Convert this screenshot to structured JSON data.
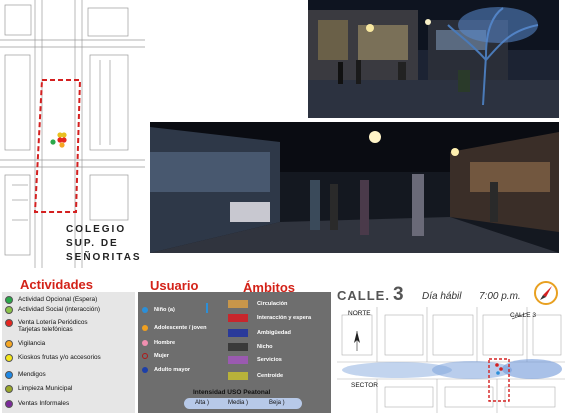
{
  "site_plan": {
    "caption_lines": [
      "COLEGIO",
      "SUP. DE",
      "SEÑORITAS"
    ]
  },
  "photos": {
    "top": {
      "subject": "night street corner with tree sculpture"
    },
    "bottom": {
      "subject": "night pedestrian street with people walking"
    }
  },
  "actividades": {
    "heading": "Actividades",
    "items": [
      {
        "label": "Actividad Opcional (Espera)",
        "color": "#2ba84a"
      },
      {
        "label": "Actividad Social (interacción)",
        "color": "#8bc34a"
      },
      {
        "label": "Venta Lotería Periódicos\nTarjetas telefónicas",
        "color": "#e52620"
      },
      {
        "label": "Vigilancia",
        "color": "#f5a623"
      },
      {
        "label": "Kioskos  frutas y/o accesorios",
        "color": "#f5e71a"
      },
      {
        "label": "Mendigos",
        "color": "#1e88e5"
      },
      {
        "label": "Limpieza Municipal",
        "color": "#9aa82a"
      },
      {
        "label": "Ventas Informales",
        "color": "#7b2a9a"
      }
    ]
  },
  "usuario": {
    "heading": "Usuario",
    "items": [
      {
        "label": "Niño (a)",
        "color": "#2b8fd9"
      },
      {
        "label": "Adolescente / joven",
        "color": "#f0a020"
      },
      {
        "label": "Hombre",
        "color": "#f08fb0"
      },
      {
        "label": "Mujer",
        "color": "#b01818"
      },
      {
        "label": "Adulto mayor",
        "color": "#1c3fa8"
      }
    ]
  },
  "ambitos": {
    "heading": "Ámbitos",
    "items": [
      {
        "label": "Circulación",
        "color": "#c8964a"
      },
      {
        "label": "Interacción y espera",
        "color": "#c8262c"
      },
      {
        "label": "Ambigüedad",
        "color": "#2a3a9a"
      },
      {
        "label": "Nicho",
        "color": "#3a3a3a"
      },
      {
        "label": "Servicios",
        "color": "#9a5ab0"
      },
      {
        "label": "Centroide",
        "color": "#b8b23a"
      }
    ]
  },
  "intensidad": {
    "title": "Intensidad USO Peatonal",
    "levels": [
      "Alta )",
      "Media )",
      "Beja )"
    ]
  },
  "calle": {
    "title": "CALLE.",
    "number": "3",
    "day": "Día hábil",
    "time": "7:00 p.m.",
    "north_label": "NORTE",
    "street_label": "CALLE 3",
    "sector_label": "SECTOR"
  }
}
